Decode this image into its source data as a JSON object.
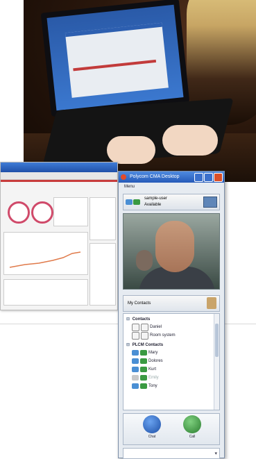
{
  "cma_window": {
    "title": "Polycom CMA Desktop",
    "menu_item": "Menu",
    "status": {
      "name": "sample-user",
      "presence": "Available"
    },
    "my_contacts_label": "My Contacts",
    "groups": [
      {
        "name": "Contacts",
        "items": [
          {
            "label": "Daniel",
            "presence": "none"
          },
          {
            "label": "Room system",
            "presence": "none"
          }
        ]
      },
      {
        "name": "PLCM Contacts",
        "items": [
          {
            "label": "Mary",
            "presence": "available"
          },
          {
            "label": "Dolores",
            "presence": "available"
          },
          {
            "label": "Kurt",
            "presence": "available"
          },
          {
            "label": "Emily",
            "presence": "offline"
          },
          {
            "label": "Tony",
            "presence": "available"
          }
        ]
      }
    ],
    "actions": {
      "chat": "Chat",
      "call": "Call"
    }
  },
  "colors": {
    "accent_top_left": "#e05a1c",
    "titlebar_blue": "#2459b8",
    "presence_available": "#3a9a42"
  }
}
